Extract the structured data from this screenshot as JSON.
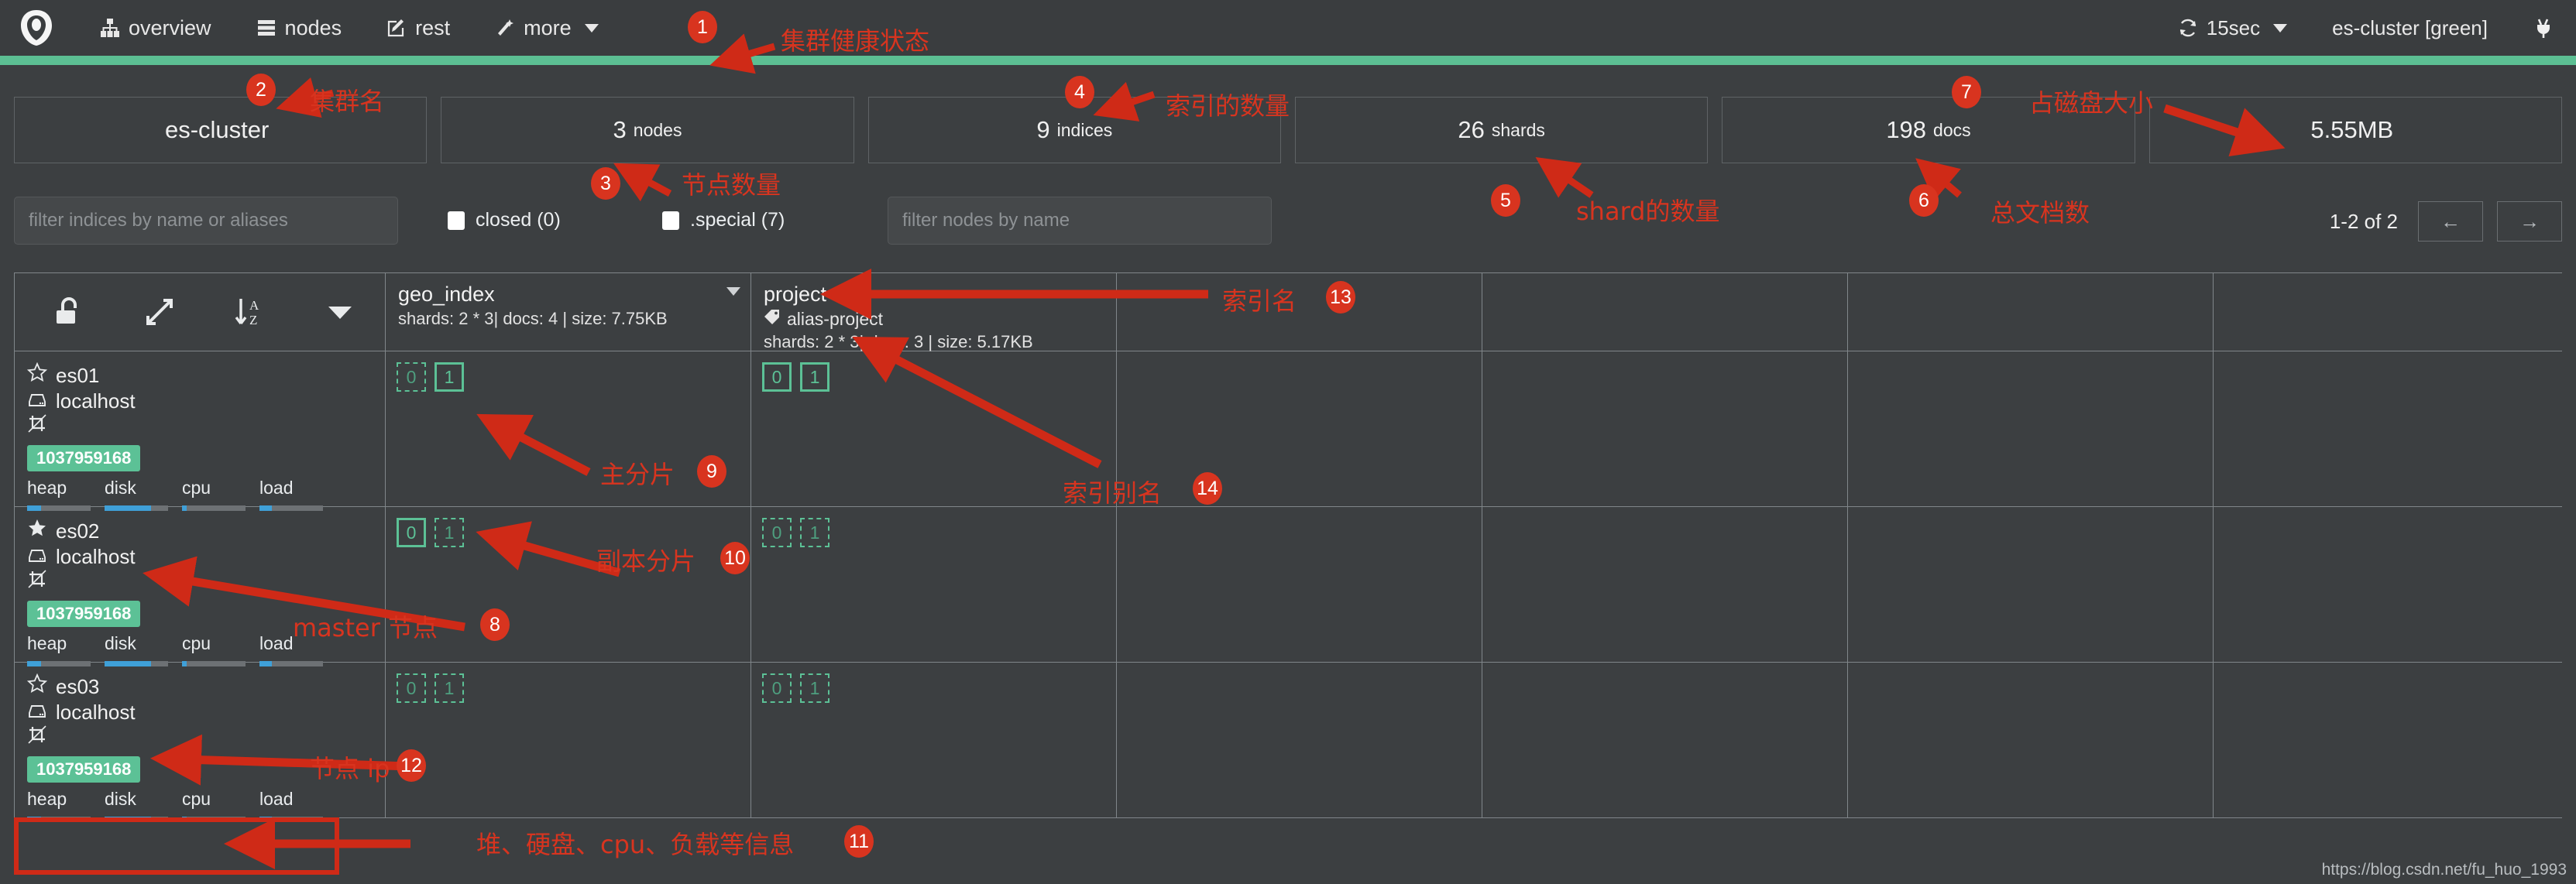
{
  "navbar": {
    "logo_icon": "cerebro-logo-icon",
    "items": [
      {
        "label": "overview",
        "icon": "sitemap-icon"
      },
      {
        "label": "nodes",
        "icon": "server-rack-icon"
      },
      {
        "label": "rest",
        "icon": "edit-square-icon"
      },
      {
        "label": "more",
        "icon": "magic-wand-icon",
        "has_caret": true
      }
    ],
    "refresh": {
      "label": "15sec",
      "icon": "refresh-icon",
      "has_caret": true
    },
    "cluster_status": "es-cluster [green]",
    "connection_icon": "plug-icon"
  },
  "health": {
    "color": "#5cbf93",
    "status": "green"
  },
  "stats": [
    {
      "value": "es-cluster",
      "unit": ""
    },
    {
      "value": "3",
      "unit": "nodes"
    },
    {
      "value": "9",
      "unit": "indices"
    },
    {
      "value": "26",
      "unit": "shards"
    },
    {
      "value": "198",
      "unit": "docs"
    },
    {
      "value": "5.55MB",
      "unit": ""
    }
  ],
  "filters": {
    "indices_placeholder": "filter indices by name or aliases",
    "indices_value": "",
    "nodes_placeholder": "filter nodes by name",
    "nodes_value": "",
    "closed_label": "closed (0)",
    "special_label": ".special (7)"
  },
  "pager": {
    "range_label": "1-2 of 2",
    "prev_label": "←",
    "next_label": "→"
  },
  "toolbar": {
    "lock_icon": "unlock-icon",
    "expand_icon": "expand-arrows-icon",
    "sort_icon": "sort-alpha-az-icon",
    "menu_icon": "chevron-down-icon"
  },
  "indices": [
    {
      "name": "geo_index",
      "alias": "",
      "meta": "shards: 2 * 3| docs: 4 | size: 7.75KB",
      "has_caret": true
    },
    {
      "name": "project",
      "alias": "alias-project",
      "alias_icon": "tag-icon",
      "meta": "shards: 2 * 3| docs: 3 | size: 5.17KB",
      "has_caret": false
    }
  ],
  "nodes": [
    {
      "name": "es01",
      "master": false,
      "star_icon": "star-outline-icon",
      "host": "localhost",
      "host_icon": "hdd-icon",
      "role_icon": "no-data-icon",
      "badge": "1037959168",
      "metrics": [
        {
          "label": "heap",
          "pct": 22
        },
        {
          "label": "disk",
          "pct": 73
        },
        {
          "label": "cpu",
          "pct": 7
        },
        {
          "label": "load",
          "pct": 20
        }
      ],
      "shards": {
        "geo_index": [
          {
            "id": "0",
            "type": "replica"
          },
          {
            "id": "1",
            "type": "primary"
          }
        ],
        "project": [
          {
            "id": "0",
            "type": "primary"
          },
          {
            "id": "1",
            "type": "primary"
          }
        ]
      }
    },
    {
      "name": "es02",
      "master": true,
      "star_icon": "star-filled-icon",
      "host": "localhost",
      "host_icon": "hdd-icon",
      "role_icon": "no-data-icon",
      "badge": "1037959168",
      "metrics": [
        {
          "label": "heap",
          "pct": 22
        },
        {
          "label": "disk",
          "pct": 73
        },
        {
          "label": "cpu",
          "pct": 7
        },
        {
          "label": "load",
          "pct": 20
        }
      ],
      "shards": {
        "geo_index": [
          {
            "id": "0",
            "type": "primary"
          },
          {
            "id": "1",
            "type": "replica"
          }
        ],
        "project": [
          {
            "id": "0",
            "type": "replica"
          },
          {
            "id": "1",
            "type": "replica"
          }
        ]
      }
    },
    {
      "name": "es03",
      "master": false,
      "star_icon": "star-outline-icon",
      "host": "localhost",
      "host_icon": "hdd-icon",
      "role_icon": "no-data-icon",
      "badge": "1037959168",
      "metrics": [
        {
          "label": "heap",
          "pct": 22
        },
        {
          "label": "disk",
          "pct": 73
        },
        {
          "label": "cpu",
          "pct": 7
        },
        {
          "label": "load",
          "pct": 20
        }
      ],
      "shards": {
        "geo_index": [
          {
            "id": "0",
            "type": "replica"
          },
          {
            "id": "1",
            "type": "replica"
          }
        ],
        "project": [
          {
            "id": "0",
            "type": "replica"
          },
          {
            "id": "1",
            "type": "replica"
          }
        ]
      }
    }
  ],
  "annotations": [
    {
      "num": "1",
      "text": "集群健康状态"
    },
    {
      "num": "2",
      "text": "集群名"
    },
    {
      "num": "3",
      "text": "节点数量"
    },
    {
      "num": "4",
      "text": "索引的数量"
    },
    {
      "num": "5",
      "text": "shard的数量"
    },
    {
      "num": "6",
      "text": "总文档数"
    },
    {
      "num": "7",
      "text": "占磁盘大小"
    },
    {
      "num": "8",
      "text": "master 节点"
    },
    {
      "num": "9",
      "text": "主分片"
    },
    {
      "num": "10",
      "text": "副本分片"
    },
    {
      "num": "11",
      "text": "堆、硬盘、cpu、负载等信息"
    },
    {
      "num": "12",
      "text": "节点 ip"
    },
    {
      "num": "13",
      "text": "索引名"
    },
    {
      "num": "14",
      "text": "索引别名"
    }
  ],
  "watermark": "https://blog.csdn.net/fu_huo_1993",
  "colors": {
    "accent_green": "#5cc196",
    "annotation_red": "#d8341f",
    "metric_blue": "#3fa0d8"
  }
}
